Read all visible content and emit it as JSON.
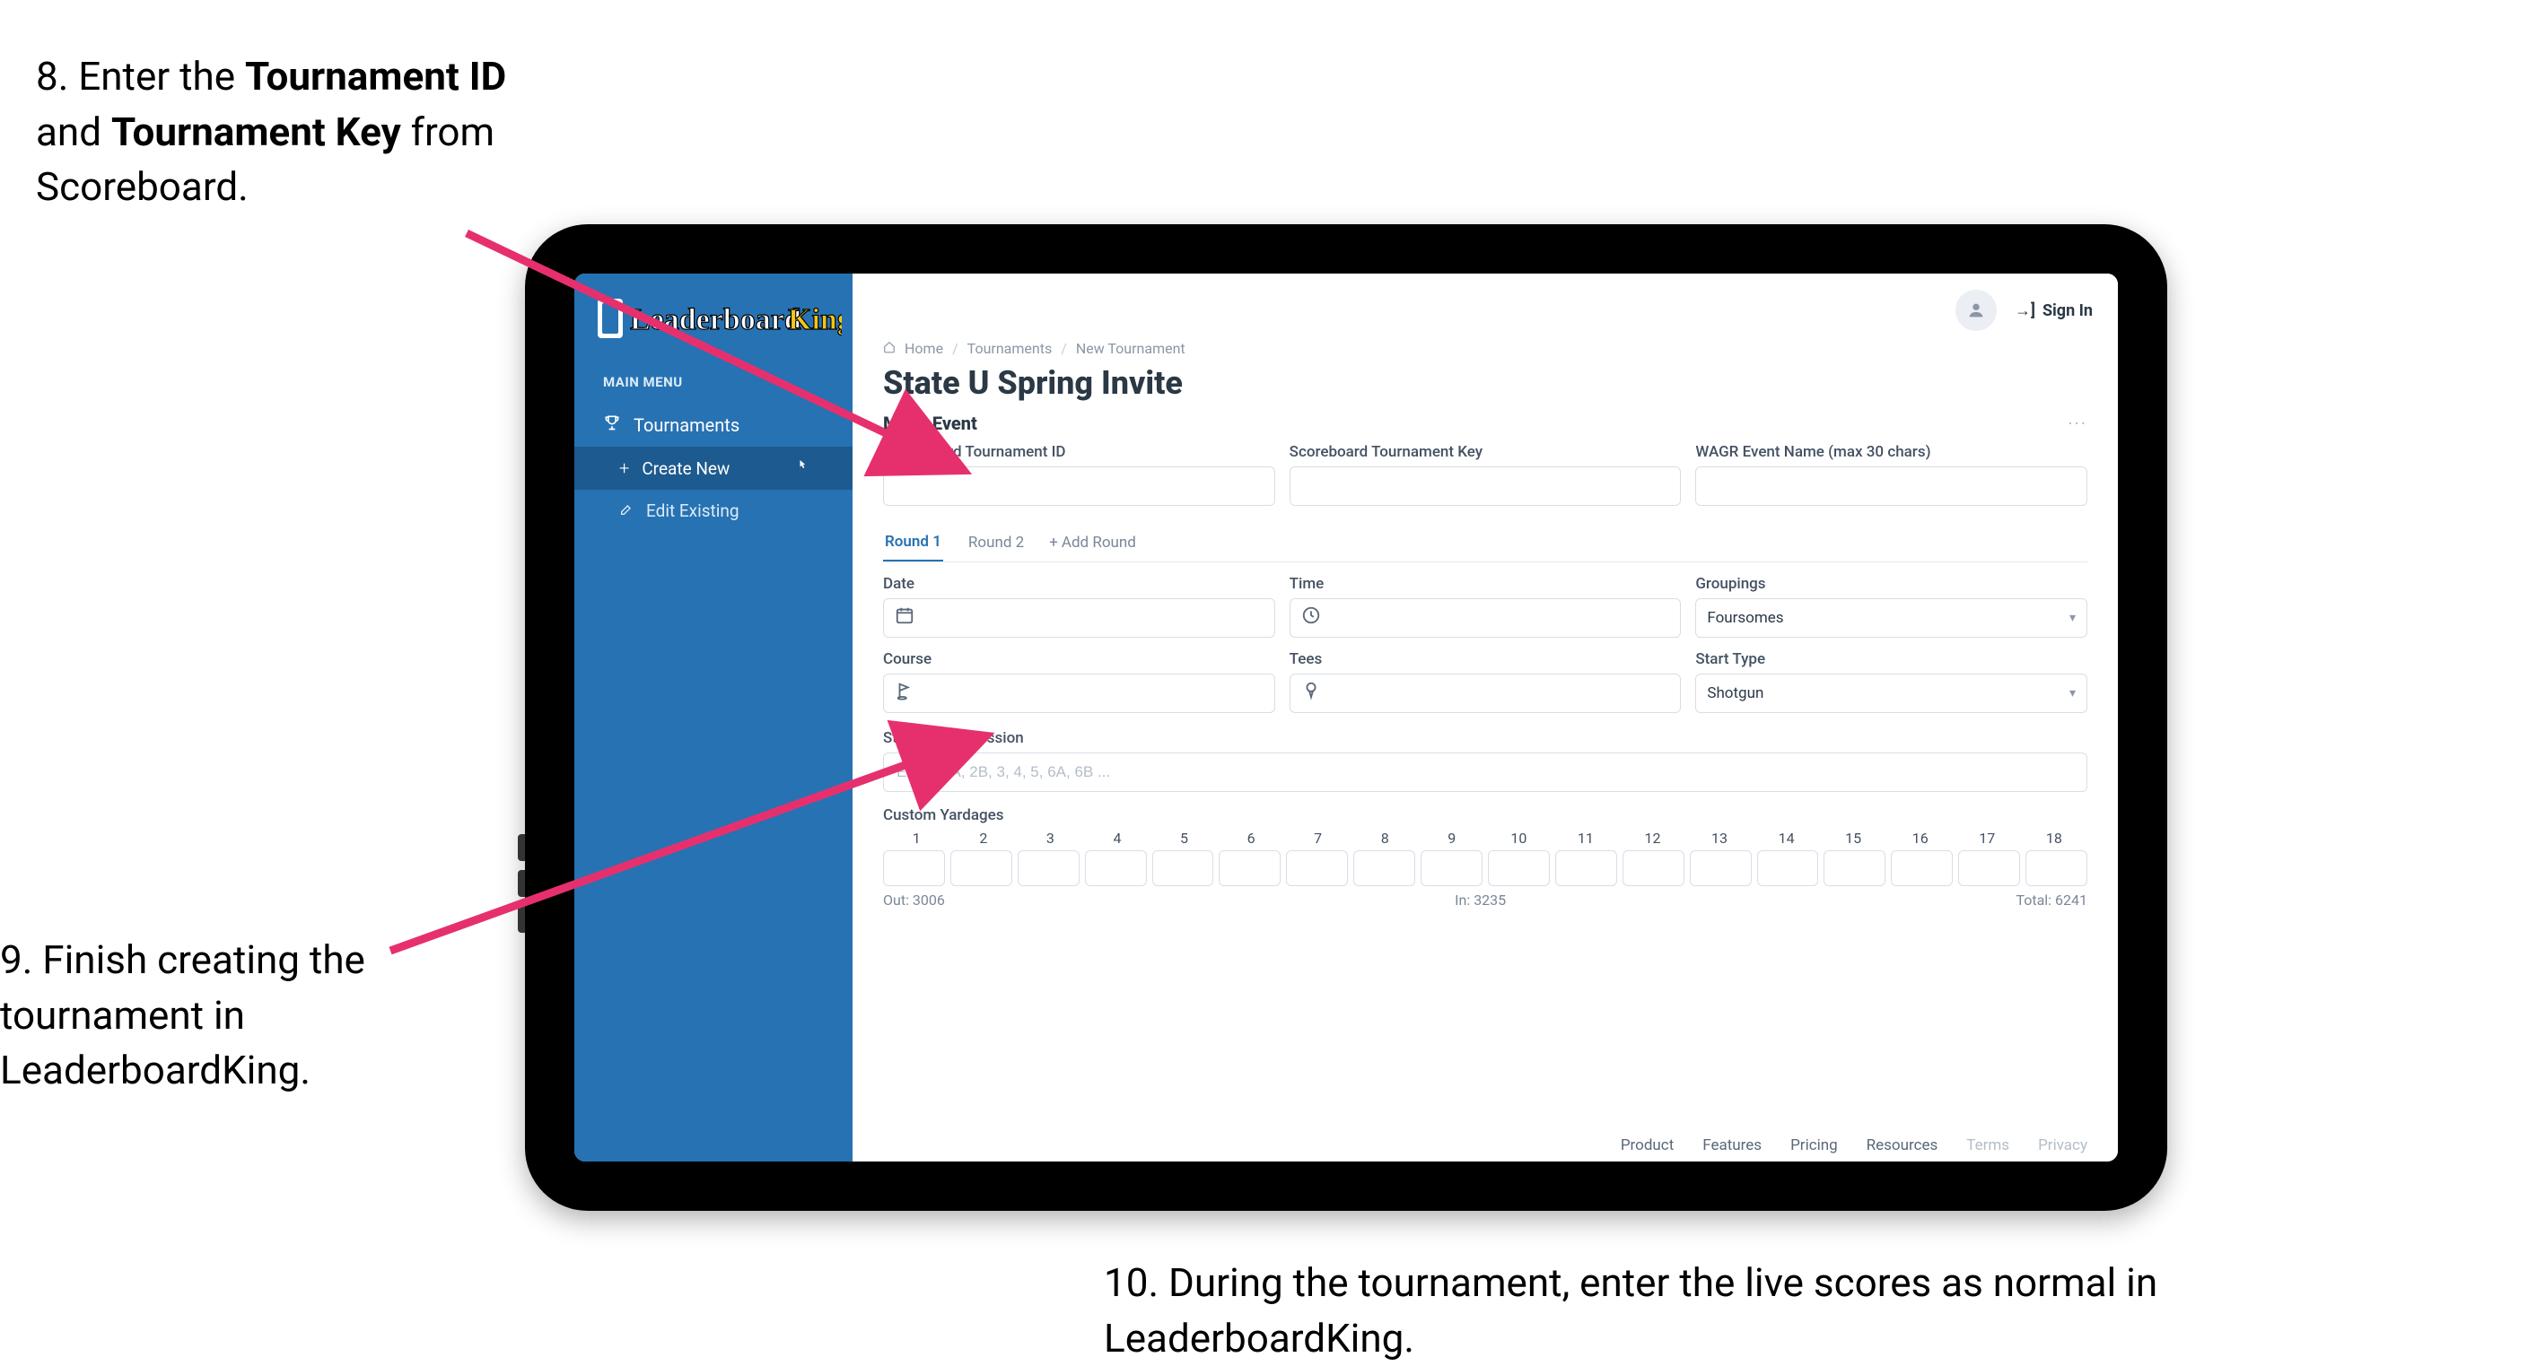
{
  "annotations": {
    "step8_prefix": "8. Enter the ",
    "step8_bold1": "Tournament ID",
    "step8_mid": " and ",
    "step8_bold2": "Tournament Key",
    "step8_suffix": " from Scoreboard.",
    "step9": "9. Finish creating the tournament in LeaderboardKing.",
    "step10": "10. During the tournament, enter the live scores as normal in LeaderboardKing."
  },
  "colors": {
    "arrow": "#e6306e",
    "sidebar": "#2772b3"
  },
  "app": {
    "logo_text": "LeaderboardKing",
    "main_menu_label": "MAIN MENU",
    "sidebar": {
      "tournaments": "Tournaments",
      "create_new": "Create New",
      "edit_existing": "Edit Existing"
    },
    "topbar": {
      "sign_in": "Sign In"
    },
    "breadcrumb": {
      "home": "Home",
      "tournaments": "Tournaments",
      "new_tournament": "New Tournament"
    },
    "page_title": "State U Spring Invite",
    "section": {
      "title": "Mens Event"
    },
    "fields": {
      "scoreboard_id_label": "Scoreboard Tournament ID",
      "scoreboard_key_label": "Scoreboard Tournament Key",
      "wagr_label": "WAGR Event Name (max 30 chars)"
    },
    "round_tabs": {
      "r1": "Round 1",
      "r2": "Round 2",
      "add": "Add Round"
    },
    "round_fields": {
      "date": "Date",
      "time": "Time",
      "groupings": "Groupings",
      "groupings_val": "Foursomes",
      "course": "Course",
      "tees": "Tees",
      "start_type": "Start Type",
      "start_type_val": "Shotgun"
    },
    "starting_prog": {
      "label": "Starting Progression",
      "placeholder": "EX: 1, 2A, 2B, 3, 4, 5, 6A, 6B ..."
    },
    "yardages": {
      "label": "Custom Yardages",
      "holes": [
        "1",
        "2",
        "3",
        "4",
        "5",
        "6",
        "7",
        "8",
        "9",
        "10",
        "11",
        "12",
        "13",
        "14",
        "15",
        "16",
        "17",
        "18"
      ],
      "out_label": "Out:",
      "out_val": "3006",
      "in_label": "In:",
      "in_val": "3235",
      "total_label": "Total:",
      "total_val": "6241"
    },
    "footer": {
      "product": "Product",
      "features": "Features",
      "pricing": "Pricing",
      "resources": "Resources",
      "terms": "Terms",
      "privacy": "Privacy"
    }
  }
}
